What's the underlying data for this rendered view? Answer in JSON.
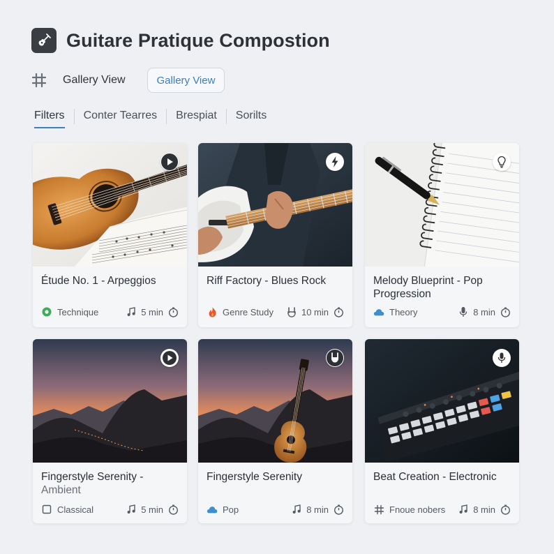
{
  "app": {
    "title": "Guitare Pratique Compostion",
    "icon": "guitar-app-icon"
  },
  "view": {
    "label": "Gallery View",
    "button_label": "Gallery View"
  },
  "tabs": [
    {
      "label": "Filters",
      "active": true
    },
    {
      "label": "Conter Tearres",
      "active": false
    },
    {
      "label": "Brespiat",
      "active": false
    },
    {
      "label": "Sorilts",
      "active": false
    }
  ],
  "cards": [
    {
      "title": "Étude No. 1 - Arpeggios",
      "title2": "",
      "category": "Technique",
      "category_icon": "green-dot-icon",
      "type_icon": "music-note-icon",
      "duration": "5 min",
      "badge_icon": "play-icon"
    },
    {
      "title": "Riff Factory - Blues Rock",
      "title2": "",
      "category": "Genre Study",
      "category_icon": "flame-icon",
      "type_icon": "rock-hand-icon",
      "duration": "10 min",
      "badge_icon": "lightning-icon"
    },
    {
      "title": "Melody Blueprint - Pop",
      "title2": "Progression",
      "category": "Theory",
      "category_icon": "cloud-icon",
      "type_icon": "microphone-icon",
      "duration": "8 min",
      "badge_icon": "lightbulb-icon"
    },
    {
      "title": "Fingerstyle Serenity -",
      "title2": "Ambient",
      "category": "Classical",
      "category_icon": "square-icon",
      "type_icon": "music-note-icon",
      "duration": "5 min",
      "badge_icon": "play-icon"
    },
    {
      "title": "Fingerstyle Serenity",
      "title2": "",
      "category": "Pop",
      "category_icon": "cloud-icon",
      "type_icon": "music-note-icon",
      "duration": "8 min",
      "badge_icon": "rock-hand-icon"
    },
    {
      "title": "Beat Creation - Electronic",
      "title2": "",
      "category": "Fnoue nobers",
      "category_icon": "hash-icon",
      "type_icon": "music-note-icon",
      "duration": "8 min",
      "badge_icon": "microphone-icon"
    }
  ],
  "colors": {
    "accent": "#3b7fc0",
    "green": "#3cae5a",
    "flame": "#e8552f",
    "cloud": "#3f8fd0"
  }
}
